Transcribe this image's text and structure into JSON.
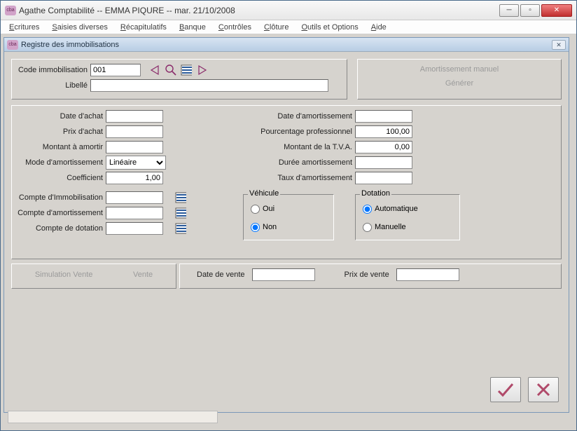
{
  "window": {
    "title": "Agathe Comptabilité  --  EMMA PIQURE  --  mar. 21/10/2008"
  },
  "menu": {
    "items": [
      {
        "u": "E",
        "rest": "critures"
      },
      {
        "u": "S",
        "rest": "aisies diverses"
      },
      {
        "u": "R",
        "rest": "écapitulatifs"
      },
      {
        "u": "B",
        "rest": "anque"
      },
      {
        "u": "C",
        "rest": "ontrôles"
      },
      {
        "u": "C",
        "rest": "lôture"
      },
      {
        "u": "O",
        "rest": "utils et Options"
      },
      {
        "u": "A",
        "rest": "ide"
      }
    ]
  },
  "child": {
    "title": "Registre des immobilisations"
  },
  "top": {
    "code_label": "Code immobilisation",
    "code_value": "001",
    "libelle_label": "Libellé",
    "libelle_value": "",
    "amort_manuel": "Amortissement manuel",
    "generer": "Générer"
  },
  "left": {
    "date_achat": "Date d'achat",
    "prix_achat": "Prix d'achat",
    "montant_amortir": "Montant à amortir",
    "mode_amort": "Mode d'amortissement",
    "mode_value": "Linéaire",
    "coefficient": "Coefficient",
    "coefficient_value": "1,00",
    "compte_immo": "Compte d'Immobilisation",
    "compte_amort": "Compte d'amortissement",
    "compte_dot": "Compte de dotation"
  },
  "right": {
    "date_amort": "Date d'amortissement",
    "pourc_pro": "Pourcentage professionnel",
    "pourc_value": "100,00",
    "montant_tva": "Montant de la T.V.A.",
    "montant_tva_value": "0,00",
    "duree_amort": "Durée amortissement",
    "taux_amort": "Taux d'amortissement"
  },
  "vehicule": {
    "legend": "Véhicule",
    "oui": "Oui",
    "non": "Non",
    "value": "Non"
  },
  "dotation": {
    "legend": "Dotation",
    "auto": "Automatique",
    "man": "Manuelle",
    "value": "Automatique"
  },
  "actions": {
    "sim_vente": "Simulation Vente",
    "vente": "Vente",
    "date_vente": "Date de vente",
    "prix_vente": "Prix de vente"
  }
}
